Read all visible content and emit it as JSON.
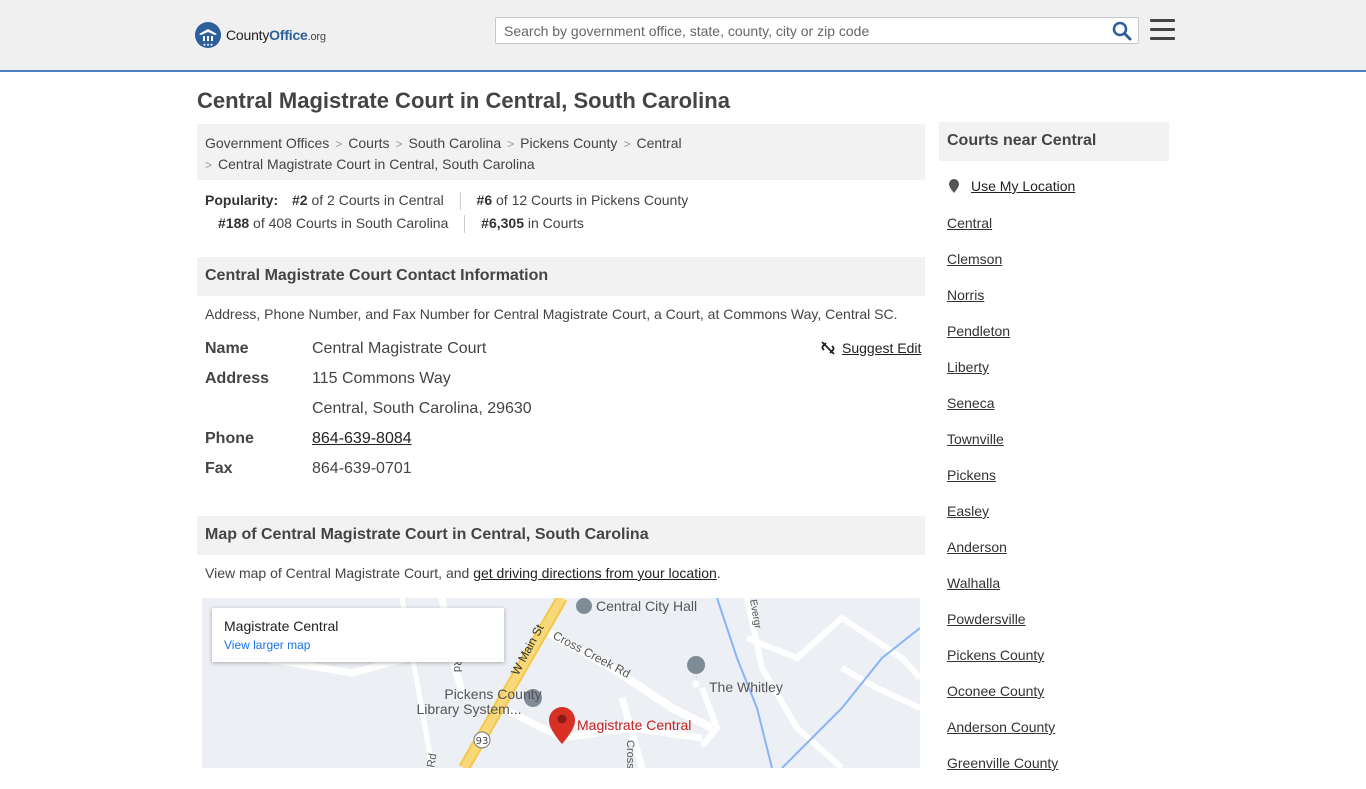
{
  "header": {
    "logo": {
      "part1": "County",
      "part2": "Office",
      "part3": ".org"
    },
    "search_placeholder": "Search by government office, state, county, city or zip code",
    "search_icon": "search-icon",
    "menu_icon": "hamburger-menu-icon"
  },
  "page_title": "Central Magistrate Court in Central, South Carolina",
  "breadcrumb": [
    "Government Offices",
    "Courts",
    "South Carolina",
    "Pickens County",
    "Central",
    "Central Magistrate Court in Central, South Carolina"
  ],
  "popularity": {
    "label": "Popularity:",
    "ranks": [
      {
        "rank": "#2",
        "text": " of 2 Courts in Central"
      },
      {
        "rank": "#6",
        "text": " of 12 Courts in Pickens County"
      },
      {
        "rank": "#188",
        "text": " of 408 Courts in South Carolina"
      },
      {
        "rank": "#6,305",
        "text": " in Courts"
      }
    ]
  },
  "contact": {
    "heading": "Central Magistrate Court Contact Information",
    "description": "Address, Phone Number, and Fax Number for Central Magistrate Court, a Court, at Commons Way, Central SC.",
    "suggest_edit": "Suggest Edit",
    "name_label": "Name",
    "name": "Central Magistrate Court",
    "address_label": "Address",
    "address_line1": "115 Commons Way",
    "address_line2": "Central, South Carolina, 29630",
    "phone_label": "Phone",
    "phone": "864-639-8084",
    "fax_label": "Fax",
    "fax": "864-639-0701"
  },
  "map_section": {
    "heading": "Map of Central Magistrate Court in Central, South Carolina",
    "desc_prefix": "View map of Central Magistrate Court, and ",
    "desc_link": "get driving directions from your location",
    "desc_suffix": ".",
    "card_title": "Magistrate Central",
    "card_link": "View larger map",
    "labels": {
      "city_hall": "Central City Hall",
      "whitley": "The Whitley",
      "library1": "Pickens County",
      "library2": "Library System...",
      "pin": "Magistrate Central",
      "main_st": "W Main St",
      "cross_creek": "Cross Creek Rd",
      "route": "93",
      "rd1": "Rd",
      "rd2": "Rd",
      "cross": "Cross",
      "everg": "Evergr"
    }
  },
  "sidebar": {
    "heading": "Courts near Central",
    "use_location": "Use My Location",
    "links": [
      "Central",
      "Clemson",
      "Norris",
      "Pendleton",
      "Liberty",
      "Seneca",
      "Townville",
      "Pickens",
      "Easley",
      "Anderson",
      "Walhalla",
      "Powdersville",
      "Pickens County",
      "Oconee County",
      "Anderson County",
      "Greenville County"
    ]
  },
  "colors": {
    "accent": "#2d5f9a",
    "header_bg": "#f0f0f0",
    "section_bg": "#f2f2f2",
    "pin_red": "#d93025"
  }
}
